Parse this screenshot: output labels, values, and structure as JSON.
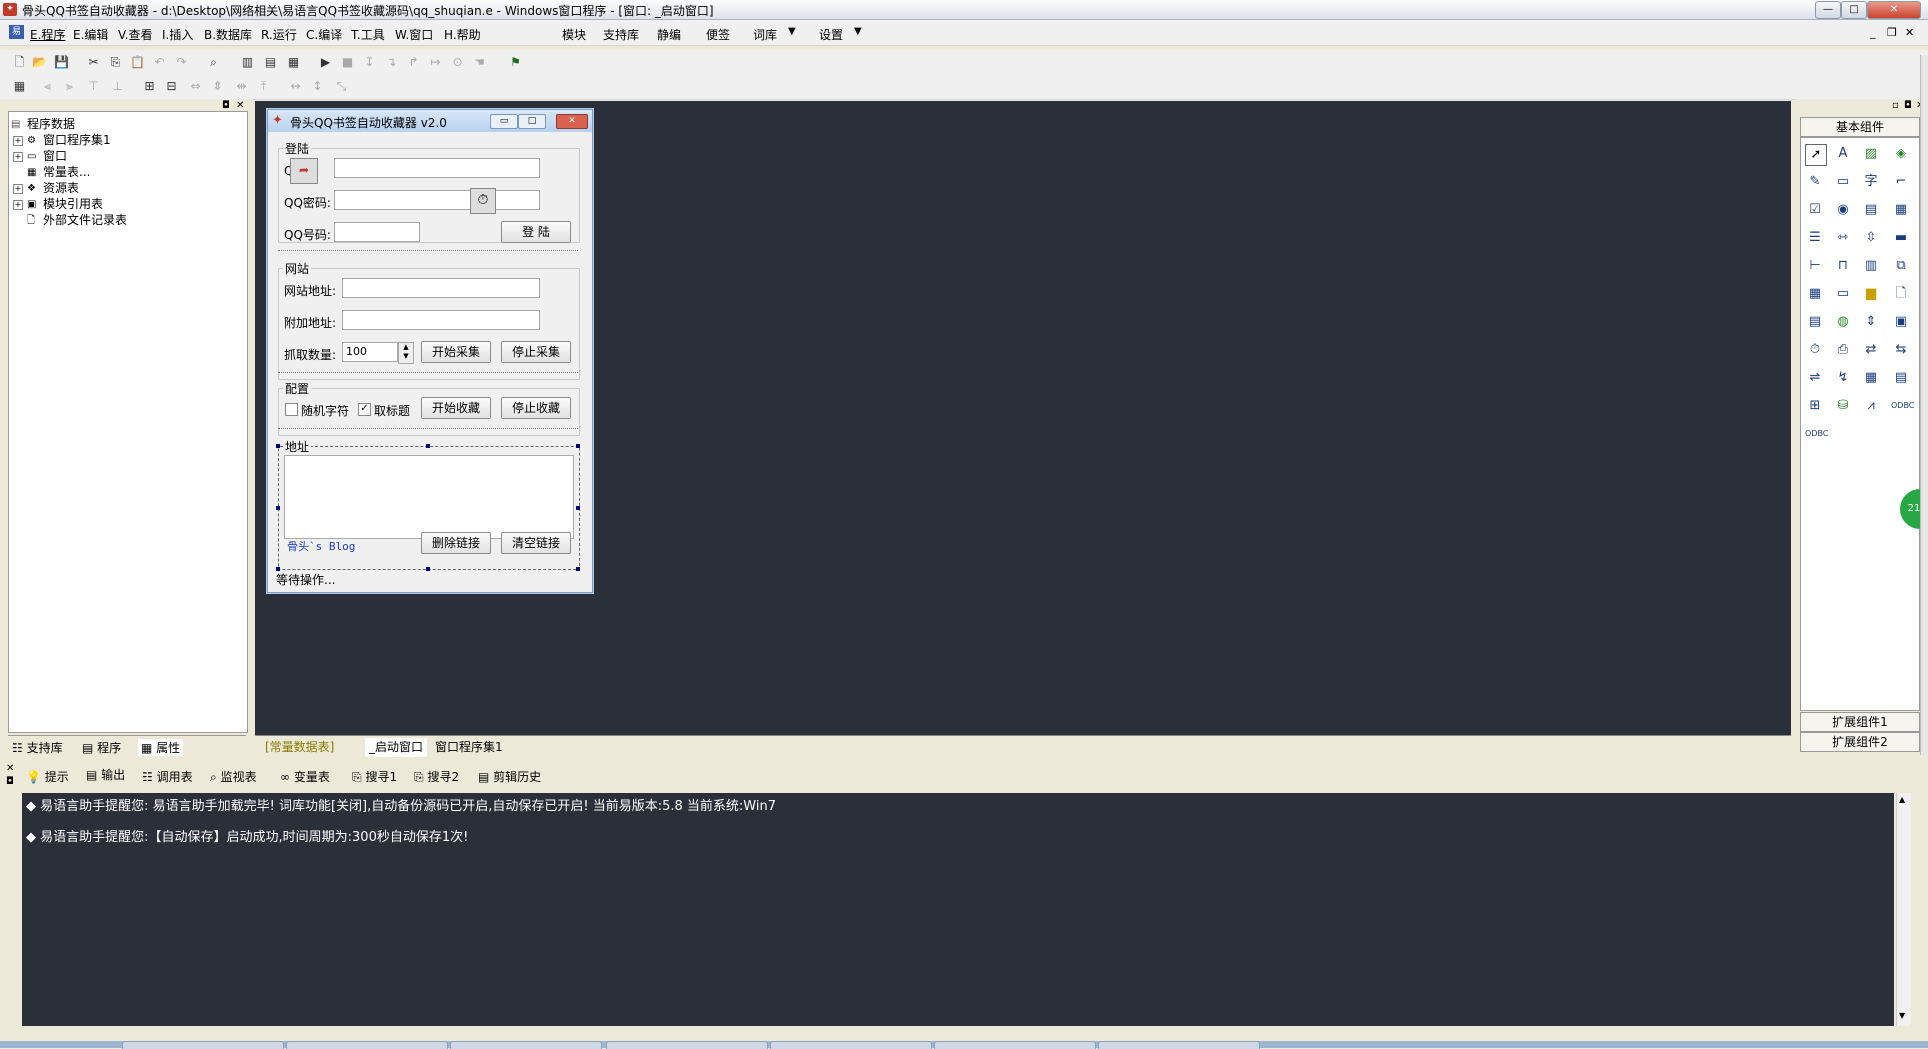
{
  "window": {
    "title": "骨头QQ书签自动收藏器 - d:\\Desktop\\网络相关\\易语言QQ书签收藏源码\\qq_shuqian.e - Windows窗口程序 - [窗口: _启动窗口]",
    "min": "—",
    "max": "□",
    "close": "✕"
  },
  "menu": {
    "items": [
      "E.程序",
      "E.编辑",
      "V.查看",
      "I.插入",
      "B.数据库",
      "R.运行",
      "C.编译",
      "T.工具",
      "W.窗口",
      "H.帮助"
    ],
    "extra": [
      "模块",
      "支持库",
      "静编",
      "便签",
      "词库",
      "设置"
    ]
  },
  "left_panel": {
    "tree": [
      {
        "label": "程序数据"
      },
      {
        "label": "窗口程序集1"
      },
      {
        "label": "窗口"
      },
      {
        "label": "常量表..."
      },
      {
        "label": "资源表"
      },
      {
        "label": "模块引用表"
      },
      {
        "label": "外部文件记录表"
      }
    ],
    "tabs": [
      "支持库",
      "程序",
      "属性"
    ]
  },
  "editor_tabs": [
    "[常量数据表]",
    "_启动窗口",
    "窗口程序集1"
  ],
  "form": {
    "title": "骨头QQ书签自动收藏器 v2.0",
    "login": {
      "group": "登陆",
      "qq_label": "Q",
      "pwd_label": "QQ密码:",
      "num_label": "QQ号码:",
      "login_btn": "登 陆"
    },
    "site": {
      "group": "网站",
      "url_label": "网站地址:",
      "extra_label": "附加地址:",
      "count_label": "抓取数量:",
      "count_value": "100",
      "start_btn": "开始采集",
      "stop_btn": "停止采集"
    },
    "config": {
      "group": "配置",
      "random_label": "随机字符",
      "random_checked": false,
      "title_label": "取标题",
      "title_checked": true,
      "start_btn": "开始收藏",
      "stop_btn": "停止收藏"
    },
    "address": {
      "group": "地址",
      "blog_link": "骨头`s Blog",
      "del_btn": "删除链接",
      "clear_btn": "清空链接"
    },
    "status": "等待操作..."
  },
  "right_panel": {
    "header": "基本组件",
    "ext1": "扩展组件1",
    "ext2": "扩展组件2"
  },
  "bottom_tabs": [
    "提示",
    "输出",
    "调用表",
    "监视表",
    "变量表",
    "搜寻1",
    "搜寻2",
    "剪辑历史"
  ],
  "output_lines": [
    "◆ 易语言助手提醒您:  易语言助手加载完毕! 词库功能[关闭],自动备份源码已开启,自动保存已开启!  当前易版本:5.8  当前系统:Win7",
    "◆ 易语言助手提醒您:【自动保存】启动成功,时间周期为:300秒自动保存1次!"
  ]
}
